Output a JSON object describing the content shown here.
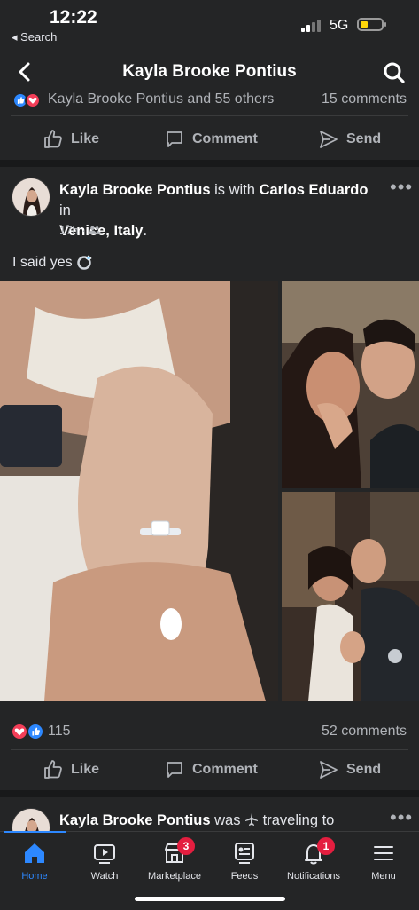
{
  "status_bar": {
    "time": "12:22",
    "back_label": "◂ Search",
    "network": "5G"
  },
  "nav": {
    "title": "Kayla Brooke Pontius"
  },
  "prev_post": {
    "reactions_text": "Kayla Brooke Pontius and 55 others",
    "comments_text": "15 comments"
  },
  "actions": {
    "like": "Like",
    "comment": "Comment",
    "send": "Send"
  },
  "post": {
    "author": "Kayla Brooke Pontius",
    "connector": " is with ",
    "tagged": "Carlos Eduardo",
    "location_prefix": " in ",
    "location": "Venice, Italy",
    "location_suffix": ".",
    "time": "17h",
    "text": "I said yes",
    "reaction_count": "115",
    "comments_text": "52 comments"
  },
  "next_post": {
    "author": "Kayla Brooke Pontius",
    "connector": " was ",
    "activity": " traveling to"
  },
  "tabs": [
    {
      "label": "Home",
      "icon": "home-icon",
      "badge": ""
    },
    {
      "label": "Watch",
      "icon": "watch-icon",
      "badge": ""
    },
    {
      "label": "Marketplace",
      "icon": "marketplace-icon",
      "badge": "3"
    },
    {
      "label": "Feeds",
      "icon": "feeds-icon",
      "badge": ""
    },
    {
      "label": "Notifications",
      "icon": "bell-icon",
      "badge": "1"
    },
    {
      "label": "Menu",
      "icon": "menu-icon",
      "badge": ""
    }
  ],
  "colors": {
    "accent": "#2d88ff",
    "background": "#18191a",
    "card": "#242526",
    "badge": "#e41e3f",
    "love": "#f33e58"
  }
}
